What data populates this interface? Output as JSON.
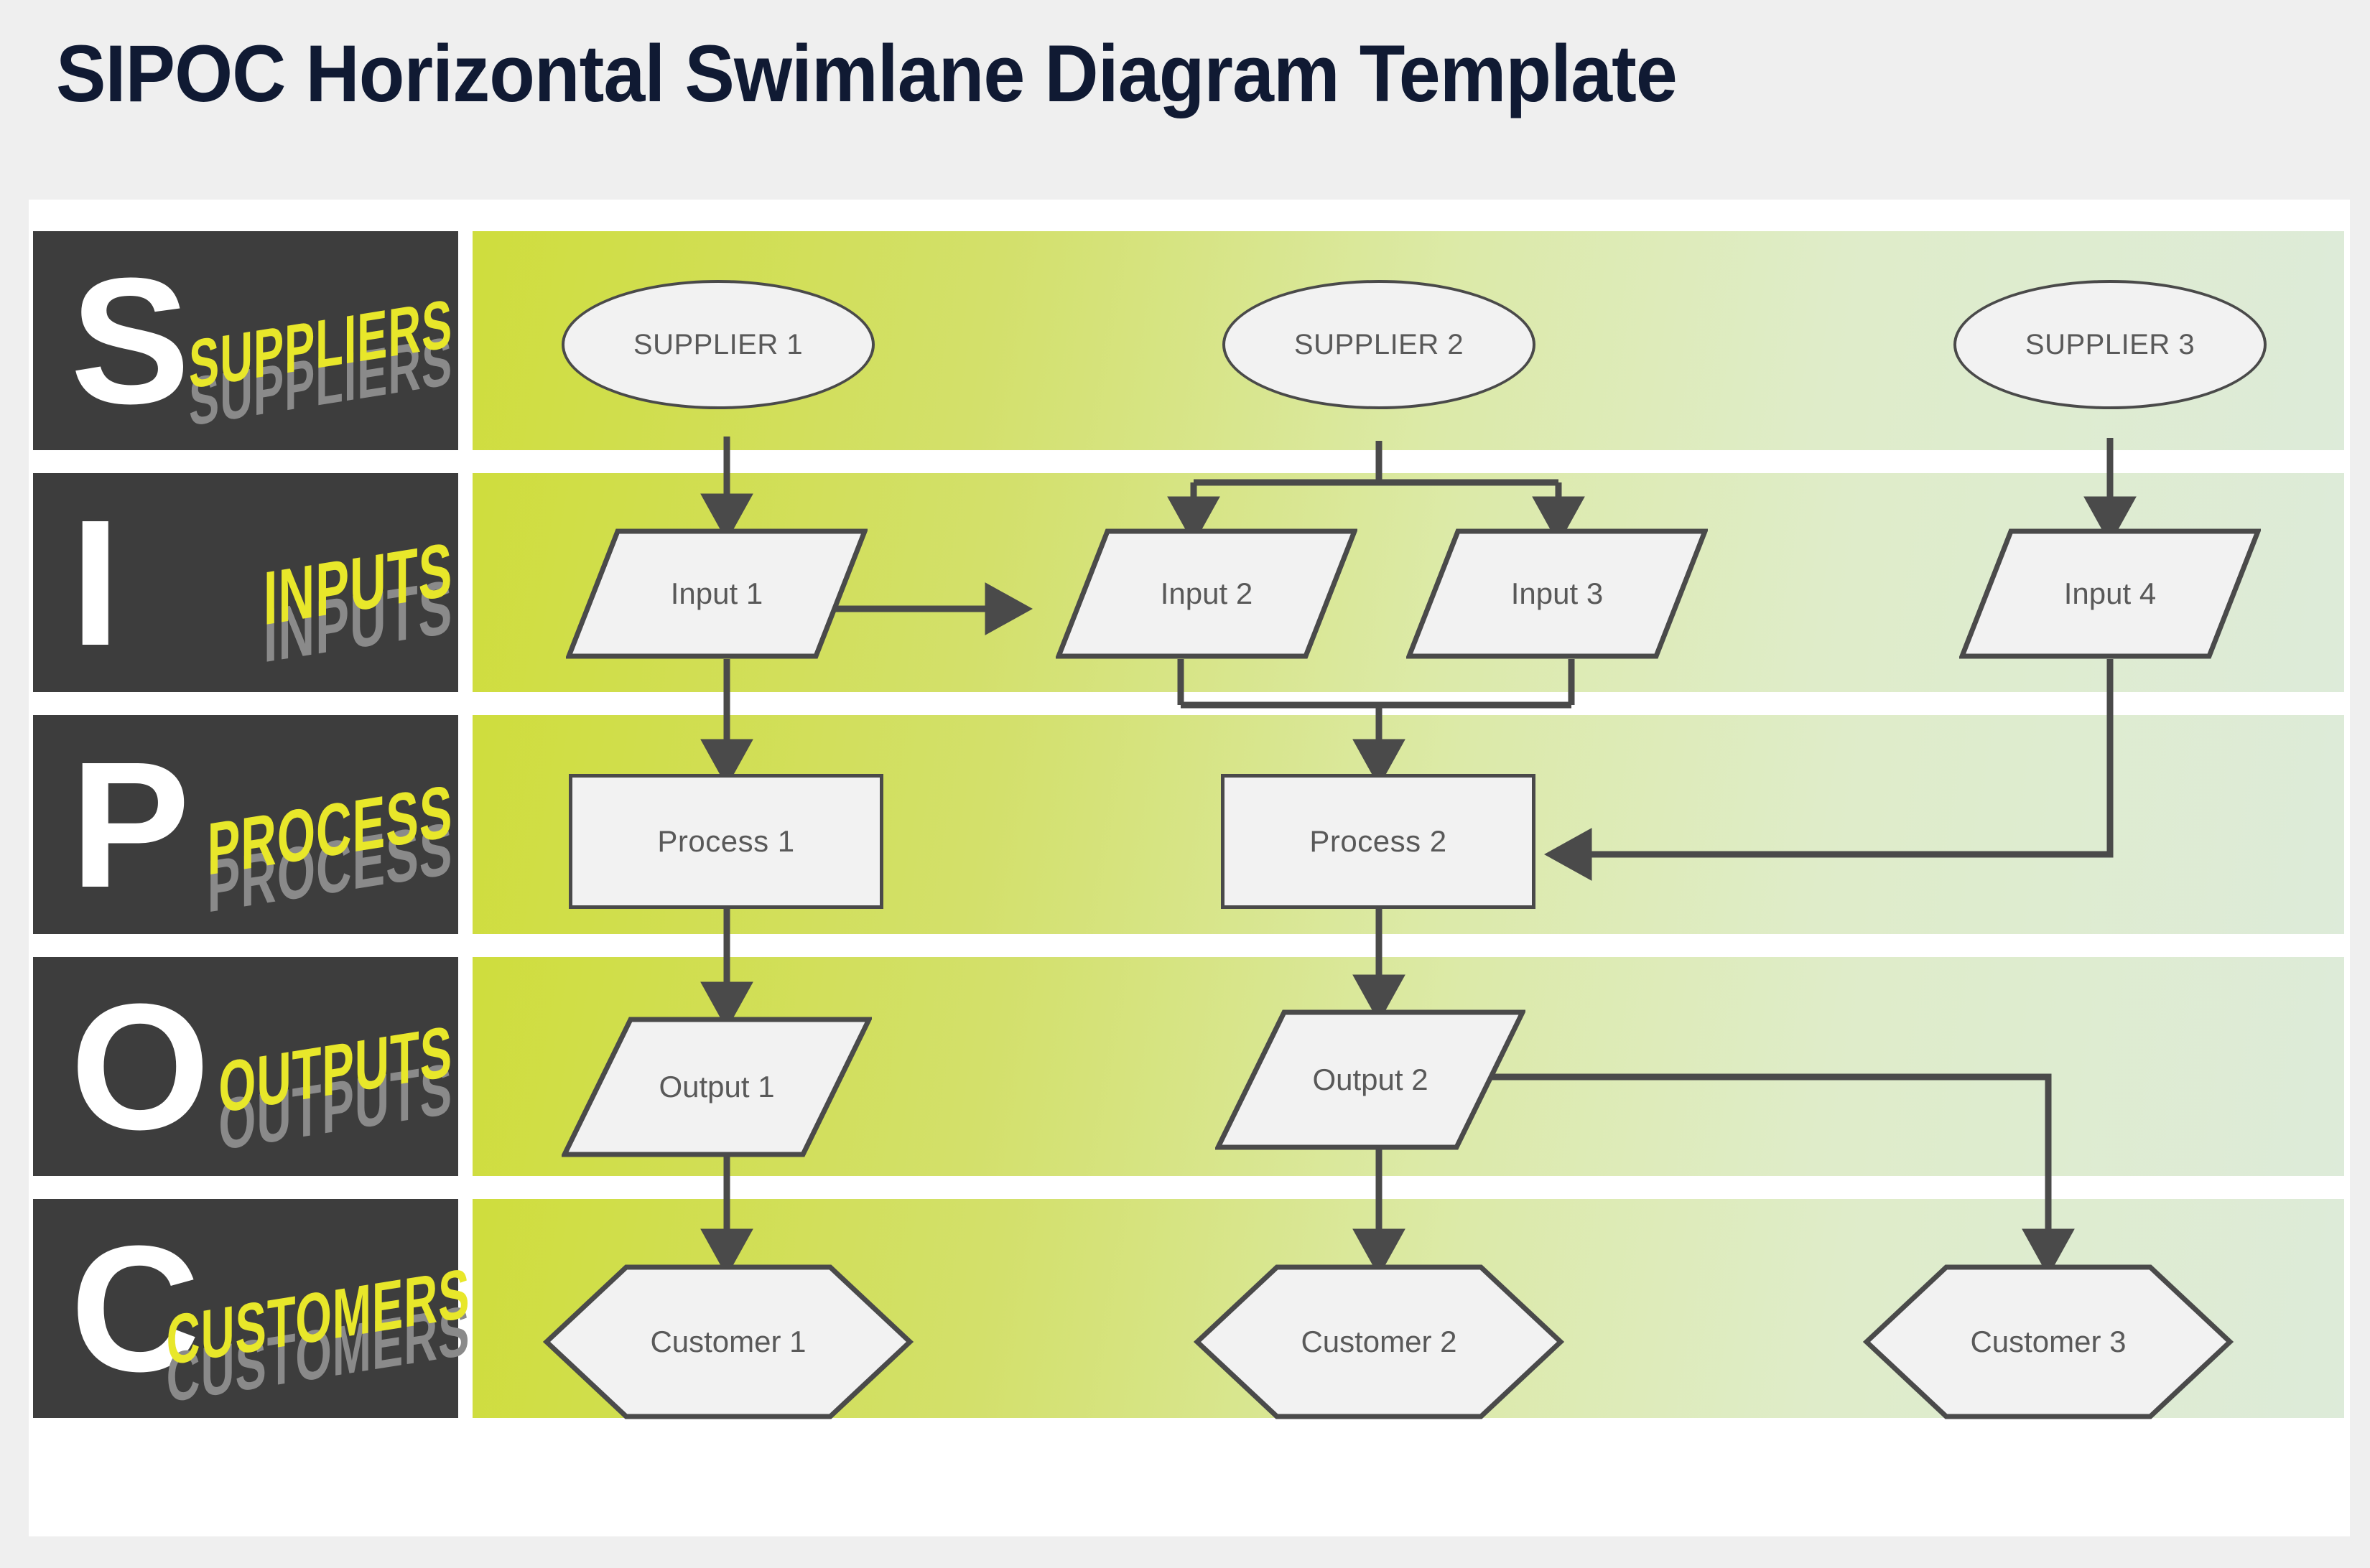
{
  "page": {
    "title": "SIPOC Horizontal Swimlane Diagram Template",
    "background_color": "#efefef",
    "title_color": "#101a33",
    "card_color": "#ffffff"
  },
  "theme": {
    "lane_label_bg": "#3d3d3d",
    "lane_letter_color": "#ffffff",
    "accent_yellow": "#e8e72a",
    "shadow_gray": "#8a8a8a",
    "lane_gradient_start": "#cfdd3d",
    "lane_gradient_end": "#ddebd9",
    "shape_fill": "#f2f2f2",
    "shape_stroke": "#4a4a4a",
    "shape_text": "#595959",
    "connector_color": "#4a4a4a"
  },
  "lanes": [
    {
      "letter": "S",
      "word": "SUPPLIERS",
      "name": "suppliers"
    },
    {
      "letter": "I",
      "word": "INPUTS",
      "name": "inputs"
    },
    {
      "letter": "P",
      "word": "PROCESS",
      "name": "process"
    },
    {
      "letter": "O",
      "word": "OUTPUTS",
      "name": "outputs"
    },
    {
      "letter": "C",
      "word": "CUSTOMERS",
      "name": "customers"
    }
  ],
  "nodes": {
    "suppliers": [
      {
        "label": "SUPPLIER 1"
      },
      {
        "label": "SUPPLIER 2"
      },
      {
        "label": "SUPPLIER 3"
      }
    ],
    "inputs": [
      {
        "label": "Input 1"
      },
      {
        "label": "Input 2"
      },
      {
        "label": "Input 3"
      },
      {
        "label": "Input 4"
      }
    ],
    "process": [
      {
        "label": "Process 1"
      },
      {
        "label": "Process 2"
      }
    ],
    "outputs": [
      {
        "label": "Output 1"
      },
      {
        "label": "Output 2"
      }
    ],
    "customers": [
      {
        "label": "Customer 1"
      },
      {
        "label": "Customer 2"
      },
      {
        "label": "Customer 3"
      }
    ]
  },
  "connections": [
    {
      "from": "SUPPLIER 1",
      "to": "Input 1",
      "style": "straight-down-arrow"
    },
    {
      "from": "SUPPLIER 2",
      "to": "Input 2",
      "style": "split-down-left-arrow"
    },
    {
      "from": "SUPPLIER 2",
      "to": "Input 3",
      "style": "split-down-right-arrow"
    },
    {
      "from": "SUPPLIER 3",
      "to": "Input 4",
      "style": "straight-down-arrow"
    },
    {
      "from": "Input 1",
      "to": "Input 2",
      "style": "horizontal-right-arrow"
    },
    {
      "from": "Input 1",
      "to": "Process 1",
      "style": "straight-down-arrow"
    },
    {
      "from": "Input 2",
      "to": "Process 2",
      "style": "merge-down-arrow"
    },
    {
      "from": "Input 3",
      "to": "Process 2",
      "style": "merge-down-arrow"
    },
    {
      "from": "Input 4",
      "to": "Process 2",
      "style": "down-then-left-arrow"
    },
    {
      "from": "Process 1",
      "to": "Output 1",
      "style": "straight-down-arrow"
    },
    {
      "from": "Process 2",
      "to": "Output 2",
      "style": "straight-down-arrow"
    },
    {
      "from": "Output 1",
      "to": "Customer 1",
      "style": "straight-down-arrow"
    },
    {
      "from": "Output 2",
      "to": "Customer 2",
      "style": "straight-down-arrow"
    },
    {
      "from": "Output 2",
      "to": "Customer 3",
      "style": "right-then-down-arrow"
    }
  ]
}
